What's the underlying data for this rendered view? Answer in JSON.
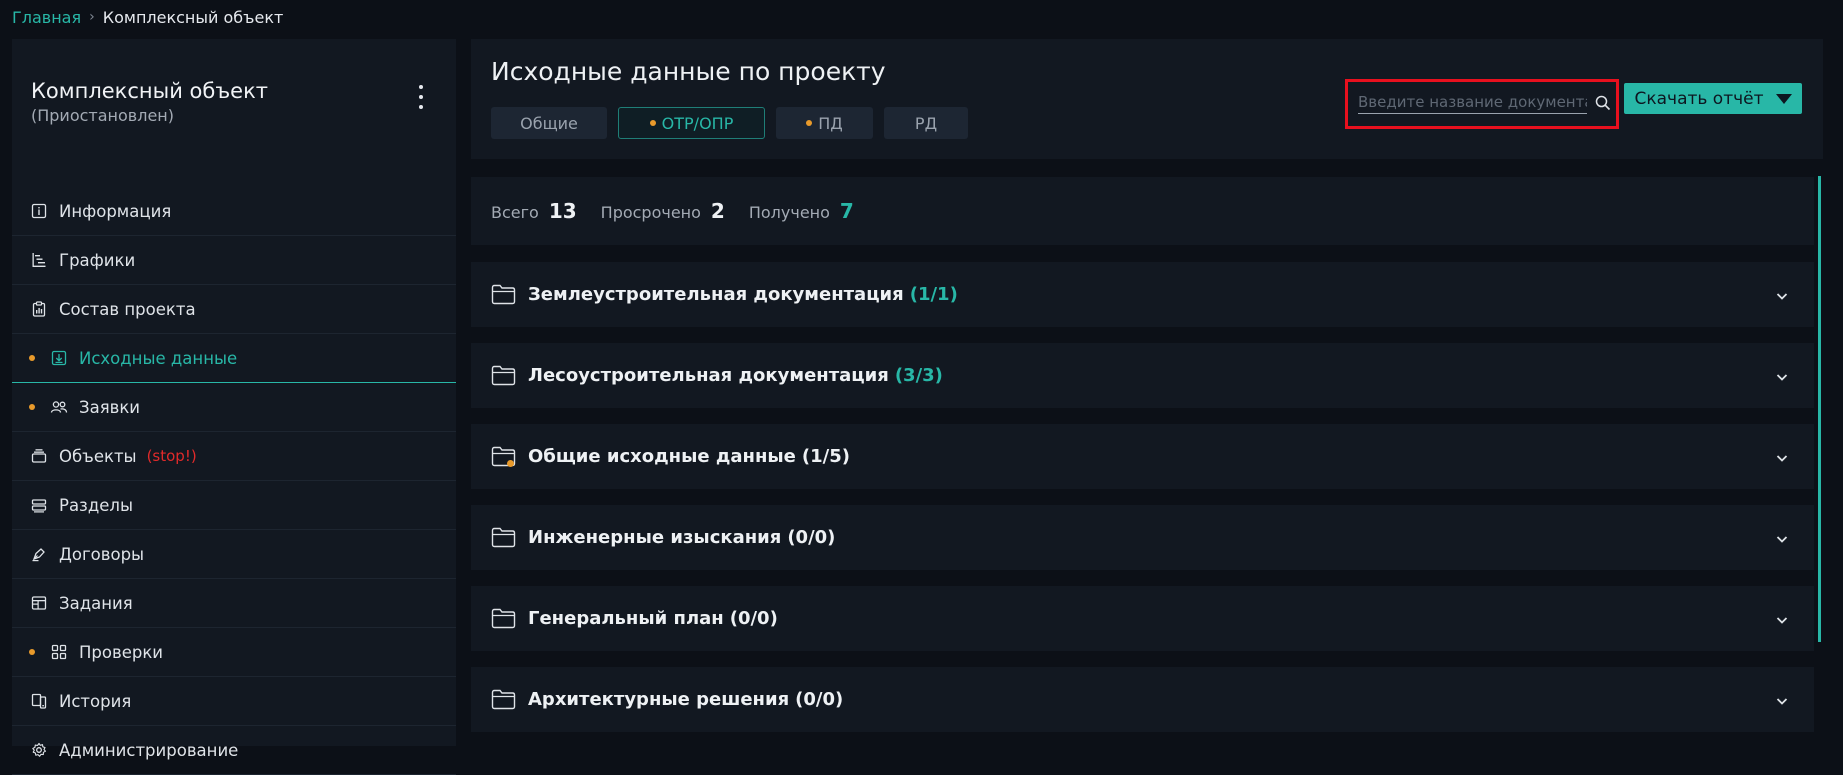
{
  "breadcrumb": {
    "home": "Главная",
    "current": "Комплексный объект"
  },
  "sidebar": {
    "title": "Комплексный объект",
    "status": "(Приостановлен)",
    "items": [
      {
        "label": "Информация",
        "icon": "info-icon"
      },
      {
        "label": "Графики",
        "icon": "gantt-icon"
      },
      {
        "label": "Состав проекта",
        "icon": "clipboard-chart-icon"
      },
      {
        "label": "Исходные данные",
        "icon": "download-box-icon",
        "active": true,
        "dot": true
      },
      {
        "label": "Заявки",
        "icon": "users-icon",
        "dot": true
      },
      {
        "label": "Объекты",
        "icon": "stack-icon",
        "badge": "(stop!)"
      },
      {
        "label": "Разделы",
        "icon": "sections-icon"
      },
      {
        "label": "Договоры",
        "icon": "pen-icon"
      },
      {
        "label": "Задания",
        "icon": "window-icon"
      },
      {
        "label": "Проверки",
        "icon": "grid-check-icon",
        "dot": true
      },
      {
        "label": "История",
        "icon": "history-icon"
      },
      {
        "label": "Администрирование",
        "icon": "gear-icon"
      }
    ]
  },
  "main": {
    "title": "Исходные данные по проекту",
    "tabs": [
      {
        "label": "Общие",
        "active": false,
        "dot": false
      },
      {
        "label": "ОТР/ОПР",
        "active": true,
        "dot": true
      },
      {
        "label": "ПД",
        "active": false,
        "dot": true
      },
      {
        "label": "РД",
        "active": false,
        "dot": false
      }
    ],
    "search": {
      "placeholder": "Введите название документа",
      "value": ""
    },
    "download_label": "Скачать отчёт"
  },
  "stats": {
    "total_label": "Всего",
    "total_value": "13",
    "overdue_label": "Просрочено",
    "overdue_value": "2",
    "received_label": "Получено",
    "received_value": "7"
  },
  "folders": [
    {
      "name": "Землеустроительная документация",
      "count": "(1/1)",
      "complete": true,
      "alert": false
    },
    {
      "name": "Лесоустроительная документация",
      "count": "(3/3)",
      "complete": true,
      "alert": false
    },
    {
      "name": "Общие исходные данные",
      "count": "(1/5)",
      "complete": false,
      "alert": true
    },
    {
      "name": "Инженерные изыскания",
      "count": "(0/0)",
      "complete": false,
      "alert": false
    },
    {
      "name": "Генеральный план",
      "count": "(0/0)",
      "complete": false,
      "alert": false
    },
    {
      "name": "Архитектурные решения",
      "count": "(0/0)",
      "complete": false,
      "alert": false
    }
  ],
  "colors": {
    "accent": "#28b7a7",
    "alert_dot": "#e89a2b",
    "stop": "#e02a2a",
    "highlight_box": "#e8101e"
  }
}
